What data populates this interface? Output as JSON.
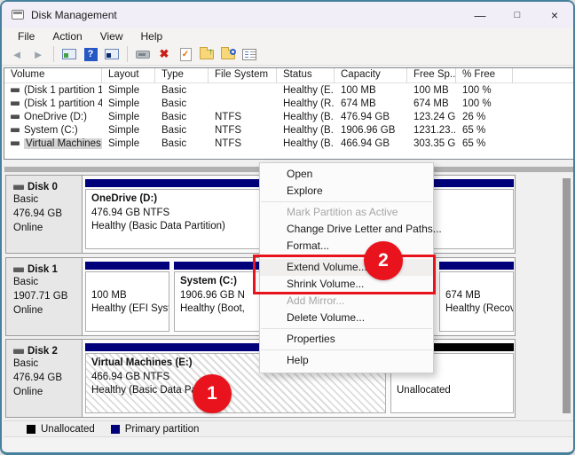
{
  "window": {
    "title": "Disk Management",
    "controls": {
      "minimize": "—",
      "maximize": "□",
      "close": "×"
    }
  },
  "menu_bar": {
    "items": [
      "File",
      "Action",
      "View",
      "Help"
    ]
  },
  "toolbar": {
    "icons": [
      "back",
      "forward",
      "console-tree",
      "help",
      "action-pane",
      "device",
      "delete",
      "check-document",
      "folder-up",
      "folder-search",
      "properties"
    ]
  },
  "volume_table": {
    "columns": [
      "Volume",
      "Layout",
      "Type",
      "File System",
      "Status",
      "Capacity",
      "Free Sp...",
      "% Free"
    ],
    "rows": [
      {
        "volume": "(Disk 1 partition 1)",
        "layout": "Simple",
        "type": "Basic",
        "file_system": "",
        "status": "Healthy (E...",
        "capacity": "100 MB",
        "free_space": "100 MB",
        "pct_free": "100 %"
      },
      {
        "volume": "(Disk 1 partition 4)",
        "layout": "Simple",
        "type": "Basic",
        "file_system": "",
        "status": "Healthy (R...",
        "capacity": "674 MB",
        "free_space": "674 MB",
        "pct_free": "100 %"
      },
      {
        "volume": "OneDrive (D:)",
        "layout": "Simple",
        "type": "Basic",
        "file_system": "NTFS",
        "status": "Healthy (B...",
        "capacity": "476.94 GB",
        "free_space": "123.24 GB",
        "pct_free": "26 %"
      },
      {
        "volume": "System (C:)",
        "layout": "Simple",
        "type": "Basic",
        "file_system": "NTFS",
        "status": "Healthy (B...",
        "capacity": "1906.96 GB",
        "free_space": "1231.23...",
        "pct_free": "65 %"
      },
      {
        "volume": "Virtual Machines (...",
        "layout": "Simple",
        "type": "Basic",
        "file_system": "NTFS",
        "status": "Healthy (B...",
        "capacity": "466.94 GB",
        "free_space": "303.35 GB",
        "pct_free": "65 %"
      }
    ]
  },
  "disks": [
    {
      "name": "Disk 0",
      "kind": "Basic",
      "size": "476.94 GB",
      "state": "Online",
      "partitions": [
        {
          "title": "OneDrive  (D:)",
          "size": "476.94 GB NTFS",
          "status": "Healthy (Basic Data Partition)"
        }
      ]
    },
    {
      "name": "Disk 1",
      "kind": "Basic",
      "size": "1907.71 GB",
      "state": "Online",
      "partitions": [
        {
          "title": "",
          "size": "100 MB",
          "status": "Healthy (EFI Syste"
        },
        {
          "title": "System  (C:)",
          "size": "1906.96 GB N",
          "status": "Healthy (Boot,"
        },
        {
          "title": "",
          "size": "674 MB",
          "status": "Healthy (Recovery Partition"
        }
      ]
    },
    {
      "name": "Disk 2",
      "kind": "Basic",
      "size": "476.94 GB",
      "state": "Online",
      "partitions": [
        {
          "title": "Virtual Machines  (E:)",
          "size": "466.94 GB NTFS",
          "status": "Healthy (Basic Data Partiti"
        },
        {
          "title": "",
          "size": "",
          "status": "Unallocated"
        }
      ]
    }
  ],
  "context_menu": {
    "items": [
      {
        "label": "Open",
        "enabled": true
      },
      {
        "label": "Explore",
        "enabled": true
      },
      {
        "label": "Mark Partition as Active",
        "enabled": false
      },
      {
        "label": "Change Drive Letter and Paths...",
        "enabled": true
      },
      {
        "label": "Format...",
        "enabled": true
      },
      {
        "label": "Extend Volume...",
        "enabled": true
      },
      {
        "label": "Shrink Volume...",
        "enabled": true
      },
      {
        "label": "Add Mirror...",
        "enabled": false
      },
      {
        "label": "Delete Volume...",
        "enabled": true
      },
      {
        "label": "Properties",
        "enabled": true
      },
      {
        "label": "Help",
        "enabled": true
      }
    ]
  },
  "legend": {
    "unallocated": "Unallocated",
    "primary": "Primary partition"
  },
  "annotations": {
    "step1": "1",
    "step2": "2"
  },
  "colors": {
    "primary_partition_bar": "#00007b",
    "unallocated_bar": "#000000",
    "annotation_red": "#e8131c",
    "window_border": "#45809c",
    "selection_gray": "#d4d4d4",
    "titlebar_bg": "#f1eef7"
  }
}
